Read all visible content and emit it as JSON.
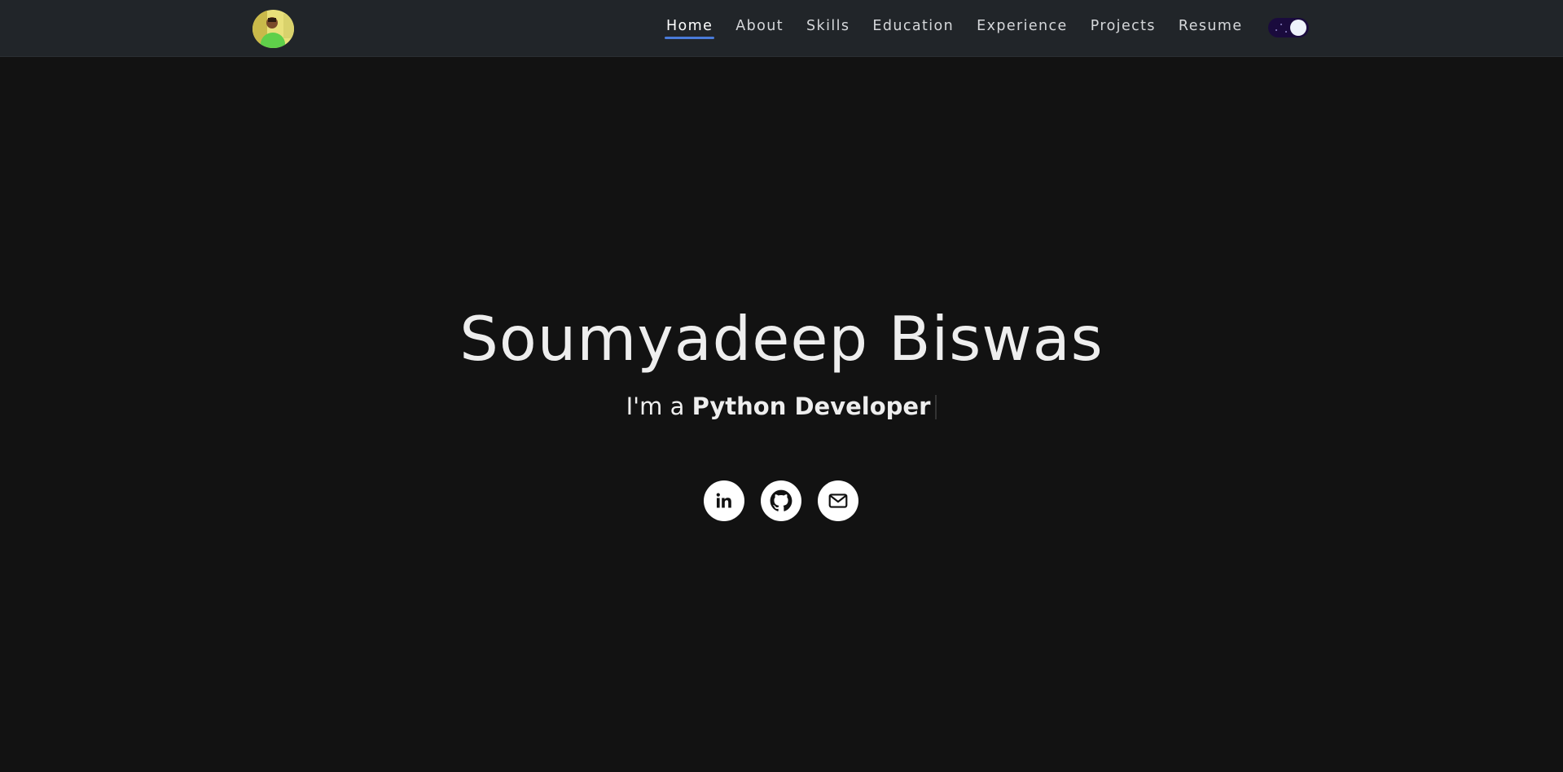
{
  "navbar": {
    "avatar_icon": "profile-photo-avatar",
    "links": [
      {
        "label": "Home",
        "active": true
      },
      {
        "label": "About",
        "active": false
      },
      {
        "label": "Skills",
        "active": false
      },
      {
        "label": "Education",
        "active": false
      },
      {
        "label": "Experience",
        "active": false
      },
      {
        "label": "Projects",
        "active": false
      },
      {
        "label": "Resume",
        "active": false
      }
    ],
    "theme_toggle": {
      "state": "dark",
      "icon": "theme-toggle-moon-stars"
    },
    "colors": {
      "background": "#212529",
      "active_underline": "#4a7bd9"
    }
  },
  "hero": {
    "name": "Soumyadeep Biswas",
    "tagline_prefix": "I'm a ",
    "tagline_role": "Python Developer",
    "socials": [
      {
        "name": "LinkedIn",
        "icon": "linkedin-icon"
      },
      {
        "name": "GitHub",
        "icon": "github-icon"
      },
      {
        "name": "Email",
        "icon": "mail-icon"
      }
    ],
    "colors": {
      "background": "#121212",
      "text": "#eeeeee"
    }
  }
}
